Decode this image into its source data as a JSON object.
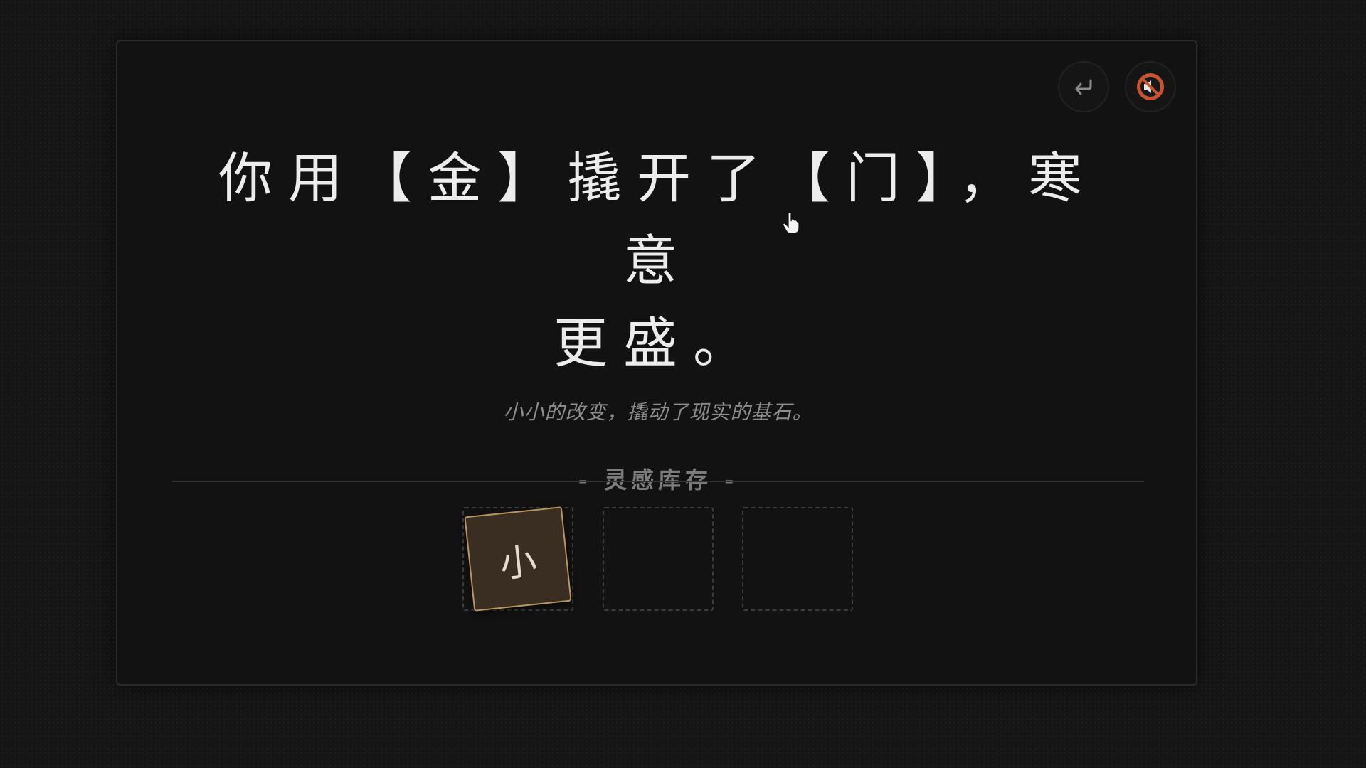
{
  "narration": {
    "line1": "你用【金】撬开了【门】，寒意",
    "line2": "更盛。"
  },
  "flavor_text": "小小的改变，撬动了现实的基石。",
  "inventory": {
    "title": "- 灵感库存 -",
    "slots": [
      {
        "glyph": "小",
        "filled": true
      },
      {
        "glyph": "",
        "filled": false
      },
      {
        "glyph": "",
        "filled": false
      }
    ]
  },
  "controls": {
    "back_icon": "return-arrow-icon",
    "mute_icon": "speaker-muted-icon"
  },
  "colors": {
    "background": "#151515",
    "panel": "#121212",
    "narration_text": "#ececec",
    "tile_fill": "#3a2d21",
    "tile_border": "#b8965f",
    "mute_accent": "#c9532f"
  }
}
